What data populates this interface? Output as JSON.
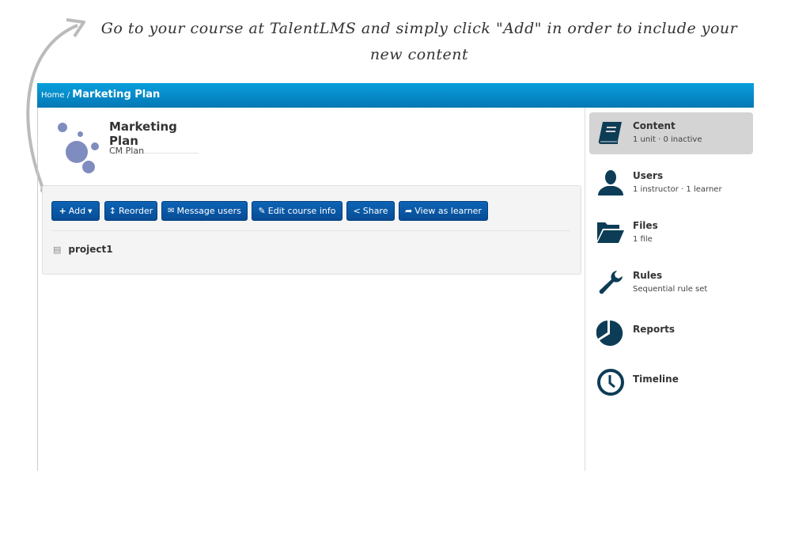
{
  "caption": "Go to your course at TalentLMS and simply click \"Add\" in order to include your new content",
  "breadcrumb": {
    "home": "Home",
    "separator": "/",
    "current": "Marketing Plan"
  },
  "course": {
    "title": "Marketing Plan",
    "subtitle": "CM Plan"
  },
  "toolbar": {
    "add": "Add",
    "reorder": "Reorder",
    "message": "Message users",
    "edit": "Edit course info",
    "share": "Share",
    "view": "View as learner"
  },
  "units": [
    {
      "name": "project1"
    }
  ],
  "sidebar": {
    "items": [
      {
        "label": "Content",
        "detail": "1 unit · 0 inactive",
        "icon": "book-icon",
        "active": true
      },
      {
        "label": "Users",
        "detail": "1 instructor · 1 learner",
        "icon": "user-icon"
      },
      {
        "label": "Files",
        "detail": "1 file",
        "icon": "folder-open-icon"
      },
      {
        "label": "Rules",
        "detail": "Sequential rule set",
        "icon": "wrench-icon"
      },
      {
        "label": "Reports",
        "detail": "",
        "icon": "pie-chart-icon"
      },
      {
        "label": "Timeline",
        "detail": "",
        "icon": "clock-icon"
      }
    ]
  },
  "colors": {
    "header": "#0377b5",
    "button": "#0a58a8",
    "icon": "#0d3d56",
    "active": "#d4d4d4"
  }
}
